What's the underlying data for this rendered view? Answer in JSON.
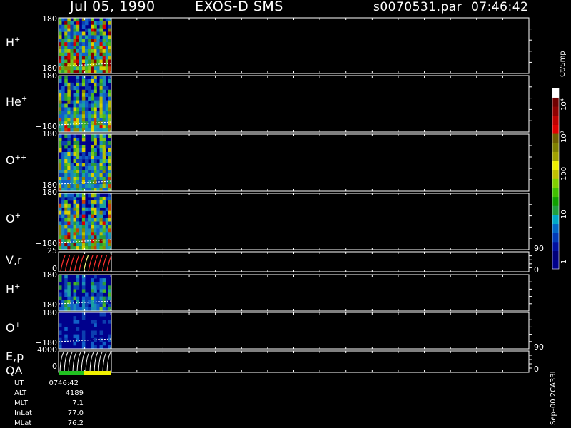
{
  "header": {
    "date": "Jul 05, 1990",
    "mission": "EXOS-D SMS",
    "file": "s0070531.par",
    "time": "07:46:42"
  },
  "panels": [
    {
      "label": "H",
      "sup": "+",
      "ticks": [
        "180",
        "−180"
      ],
      "right_ticks": []
    },
    {
      "label": "He",
      "sup": "+",
      "ticks": [
        "180",
        "−180"
      ],
      "right_ticks": []
    },
    {
      "label": "O",
      "sup": "++",
      "ticks": [
        "180",
        "−180"
      ],
      "right_ticks": []
    },
    {
      "label": "O",
      "sup": "+",
      "ticks": [
        "180",
        "−180"
      ],
      "right_ticks": []
    },
    {
      "label": "V,r",
      "sup": "",
      "ticks": [
        "25",
        "0"
      ],
      "right_ticks": [
        "90",
        "0"
      ]
    },
    {
      "label": "H",
      "sup": "+",
      "ticks": [
        "180",
        "−180"
      ],
      "right_ticks": []
    },
    {
      "label": "O",
      "sup": "+",
      "ticks": [
        "180",
        "−180"
      ],
      "right_ticks": []
    },
    {
      "label": "E,p",
      "sup": "",
      "label2": "QA",
      "ticks": [
        "4000",
        "0"
      ],
      "right_ticks": [
        "90",
        "0"
      ]
    }
  ],
  "colorbar": {
    "unit": "Ct/Smp",
    "labels": [
      "10⁴",
      "10³",
      "100",
      "10",
      "1"
    ]
  },
  "footer": [
    {
      "key": "UT",
      "value": "0746:42"
    },
    {
      "key": "ALT",
      "value": "4189"
    },
    {
      "key": "MLT",
      "value": "7.1"
    },
    {
      "key": "InLat",
      "value": "77.0"
    },
    {
      "key": "MLat",
      "value": "76.2"
    }
  ],
  "stamp": "Sep–00  2CA33L",
  "colors": {
    "background": "#000000",
    "axis": "#ffffff",
    "low": "#00008c",
    "mid": "#2a7a2a",
    "high": "#d80000"
  },
  "chart_data": {
    "type": "heatmap",
    "panels": [
      "H+",
      "He+",
      "O++",
      "O+",
      "V,r",
      "H+",
      "O+",
      "E,p QA"
    ],
    "y_ranges": [
      [
        -180,
        180
      ],
      [
        -180,
        180
      ],
      [
        -180,
        180
      ],
      [
        -180,
        180
      ],
      [
        0,
        25
      ],
      [
        -180,
        180
      ],
      [
        -180,
        180
      ],
      [
        0,
        4000
      ]
    ],
    "colorbar_ticks": [
      "1",
      "10",
      "100",
      "10³",
      "10⁴"
    ]
  }
}
